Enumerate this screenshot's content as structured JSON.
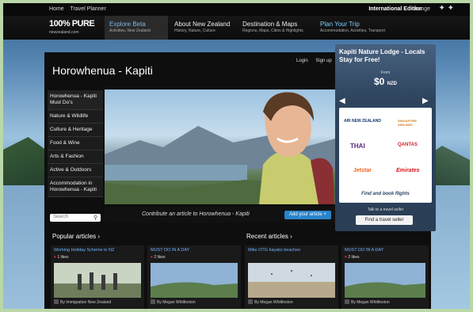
{
  "topbar": {
    "links": [
      "Home",
      "Travel Planner"
    ],
    "edition": "International Edition",
    "change": "change"
  },
  "logo": {
    "text": "100% PURE",
    "sub": "newzealand.com"
  },
  "nav": [
    {
      "label": "Explore Beta",
      "sub": "Activities, New Zealand"
    },
    {
      "label": "About New Zealand",
      "sub": "History, Nature, Culture"
    },
    {
      "label": "Destination & Maps",
      "sub": "Regions, Maps, Cities & Highlights"
    },
    {
      "label": "Plan Your Trip",
      "sub": "Accommodation, Activities, Transport"
    }
  ],
  "account": {
    "login": "Login",
    "signup": "Sign up"
  },
  "page": {
    "title": "Horowhenua - Kapiti"
  },
  "sidebar": {
    "items": [
      "Horowhenua - Kapiti Must Do's",
      "Nature & Wildlife",
      "Culture & Heritage",
      "Food & Wine",
      "Arts & Fashion",
      "Active & Outdoors",
      "Accommodation in Horowhenua - Kapiti"
    ],
    "search_placeholder": "Search"
  },
  "contribute": {
    "text": "Contribute an article to Horowhenua - Kapiti",
    "button": "Add your article +"
  },
  "sections": {
    "popular": "Popular articles ›",
    "recent": "Recent articles ›"
  },
  "cards": [
    {
      "title": "Working Holiday Scheme in NZ",
      "likes": "1 likes",
      "by": "By Immigration New Zealand"
    },
    {
      "title": "MUST DO IN A DAY",
      "likes": "2 likes",
      "by": "By Megan Whittleston"
    },
    {
      "title": "Mike OTG kayaks beaches",
      "likes": "",
      "by": "By Megan Whittleston"
    },
    {
      "title": "MUST DO IN A DAY",
      "likes": "2 likes",
      "by": "By Megan Whittleston"
    }
  ],
  "promo": {
    "title": "Kapiti Nature Lodge - Locals Stay for Free!",
    "from": "From",
    "price": "$0",
    "unit": "NZD",
    "airlines": [
      "AIR NEW ZEALAND",
      "SINGAPORE AIRLINES",
      "THAI",
      "QANTAS",
      "Jetstar",
      "Emirates"
    ],
    "find_book": "Find and book flights",
    "travel_label": "Talk to a travel seller",
    "seller_button": "Find a travel seller"
  },
  "colors": {
    "accent": "#2a84c9",
    "link": "#6fb4ff",
    "promo_bg": "#2e445d"
  }
}
